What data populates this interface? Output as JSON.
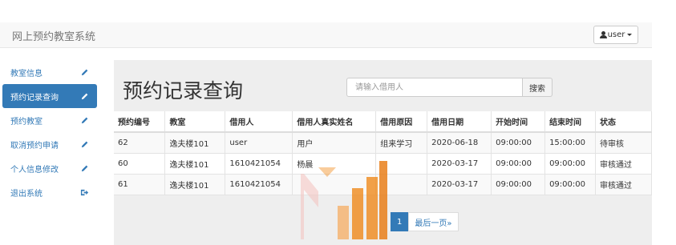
{
  "header": {
    "app_title": "网上预约教室系统",
    "user_label": "user"
  },
  "sidebar": {
    "items": [
      {
        "label": "教室信息",
        "icon": "pencil-icon"
      },
      {
        "label": "预约记录查询",
        "icon": "pencil-icon",
        "active": true
      },
      {
        "label": "预约教室",
        "icon": "pencil-icon"
      },
      {
        "label": "取消预约申请",
        "icon": "pencil-icon"
      },
      {
        "label": "个人信息修改",
        "icon": "pencil-icon"
      },
      {
        "label": "退出系统",
        "icon": "logout-icon"
      }
    ]
  },
  "main": {
    "title": "预约记录查询",
    "search": {
      "placeholder": "请输入借用人",
      "value": "",
      "button_label": "搜索"
    },
    "table": {
      "headers": [
        "预约编号",
        "教室",
        "借用人",
        "借用人真实姓名",
        "借用原因",
        "借用日期",
        "开始时间",
        "结束时间",
        "状态"
      ],
      "rows": [
        [
          "62",
          "逸夫楼101",
          "user",
          "用户",
          "组来学习",
          "2020-06-18",
          "09:00:00",
          "15:00:00",
          "待审核"
        ],
        [
          "60",
          "逸夫楼101",
          "1610421054",
          "杨晨",
          "",
          "2020-03-17",
          "09:00:00",
          "09:00:00",
          "审核通过"
        ],
        [
          "61",
          "逸夫楼101",
          "1610421054",
          "",
          "",
          "2020-03-17",
          "09:00:00",
          "09:00:00",
          "审核通过"
        ]
      ]
    },
    "pagination": {
      "current": "1",
      "last_label": "最后一页»"
    }
  },
  "colors": {
    "primary": "#337ab7",
    "panel_bg": "#eeeeee",
    "navbar_bg": "#f8f8f8",
    "watermark_orange": "#f08a1c",
    "watermark_pink": "#f3c2bd"
  }
}
